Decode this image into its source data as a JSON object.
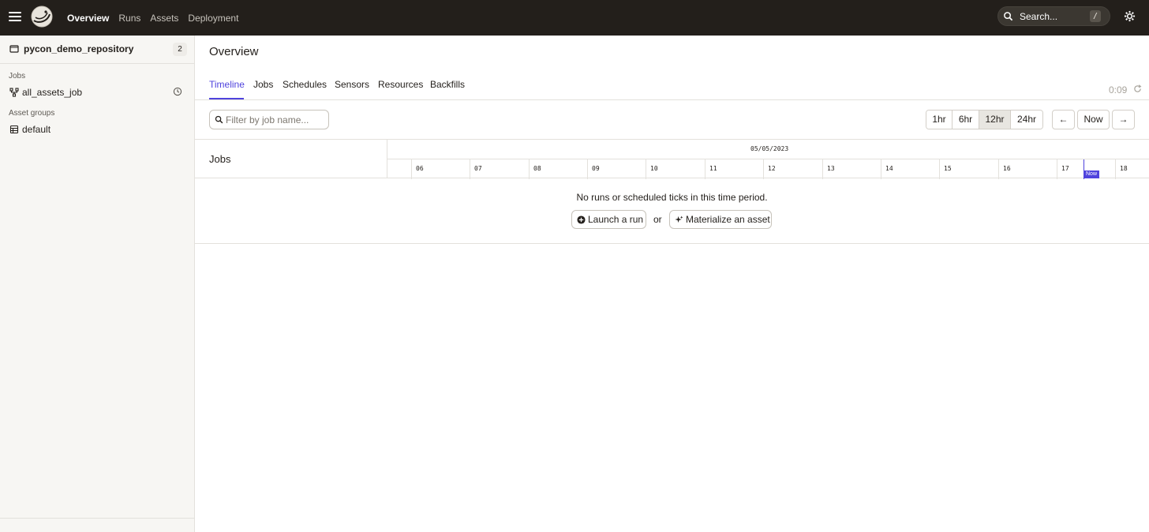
{
  "topbar": {
    "nav": [
      "Overview",
      "Runs",
      "Assets",
      "Deployment"
    ],
    "active_nav": "Overview",
    "search_placeholder": "Search...",
    "search_shortcut": "/"
  },
  "sidebar": {
    "repo_name": "pycon_demo_repository",
    "repo_count": "2",
    "jobs_label": "Jobs",
    "jobs": [
      "all_assets_job"
    ],
    "asset_groups_label": "Asset groups",
    "asset_groups": [
      "default"
    ]
  },
  "main": {
    "title": "Overview",
    "tabs": [
      "Timeline",
      "Jobs",
      "Schedules",
      "Sensors",
      "Resources",
      "Backfills"
    ],
    "active_tab": "Timeline",
    "refresh_timer": "0:09",
    "filter_placeholder": "Filter by job name...",
    "ranges": [
      "1hr",
      "6hr",
      "12hr",
      "24hr"
    ],
    "selected_range": "12hr",
    "prev_label": "←",
    "now_label": "Now",
    "next_label": "→"
  },
  "timeline": {
    "jobs_label": "Jobs",
    "date": "05/05/2023",
    "hours": [
      "06",
      "07",
      "08",
      "09",
      "10",
      "11",
      "12",
      "13",
      "14",
      "15",
      "16",
      "17",
      "18"
    ],
    "now_badge": "Now",
    "empty_message": "No runs or scheduled ticks in this time period.",
    "launch_run_label": "Launch a run",
    "or_label": "or",
    "materialize_label": "Materialize an asset"
  },
  "colors": {
    "topbar_bg": "#231f1b",
    "accent": "#4f43dd",
    "sidebar_bg": "#f7f6f3"
  }
}
